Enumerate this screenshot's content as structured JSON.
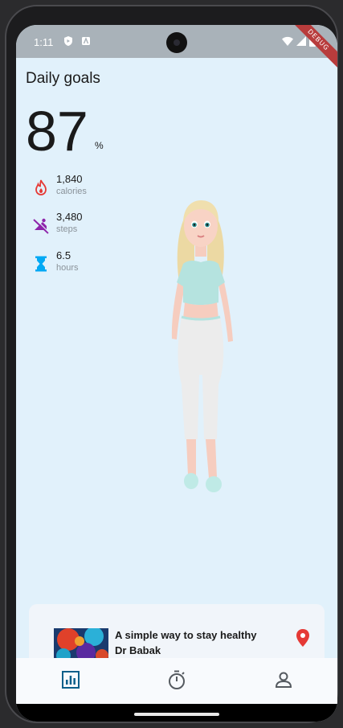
{
  "status_bar": {
    "time": "1:11",
    "debug_label": "DEBUG"
  },
  "page": {
    "title": "Daily goals",
    "percent_value": "87",
    "percent_unit": "%"
  },
  "stats": [
    {
      "value": "1,840",
      "label": "calories",
      "icon": "flame-icon",
      "color": "#e53935"
    },
    {
      "value": "3,480",
      "label": "steps",
      "icon": "walk-off-icon",
      "color": "#8e24aa"
    },
    {
      "value": "6.5",
      "label": "hours",
      "icon": "hourglass-icon",
      "color": "#03a9f4"
    }
  ],
  "card": {
    "title": "A simple way to stay healthy",
    "subtitle": "Dr Babak",
    "pin_color": "#e53935"
  },
  "nav": {
    "items": [
      {
        "name": "stats",
        "icon": "bar-chart-icon",
        "active": true
      },
      {
        "name": "timer",
        "icon": "timer-icon",
        "active": false
      },
      {
        "name": "profile",
        "icon": "person-icon",
        "active": false
      }
    ],
    "active_color": "#0b5f8a",
    "inactive_color": "#555a60"
  }
}
